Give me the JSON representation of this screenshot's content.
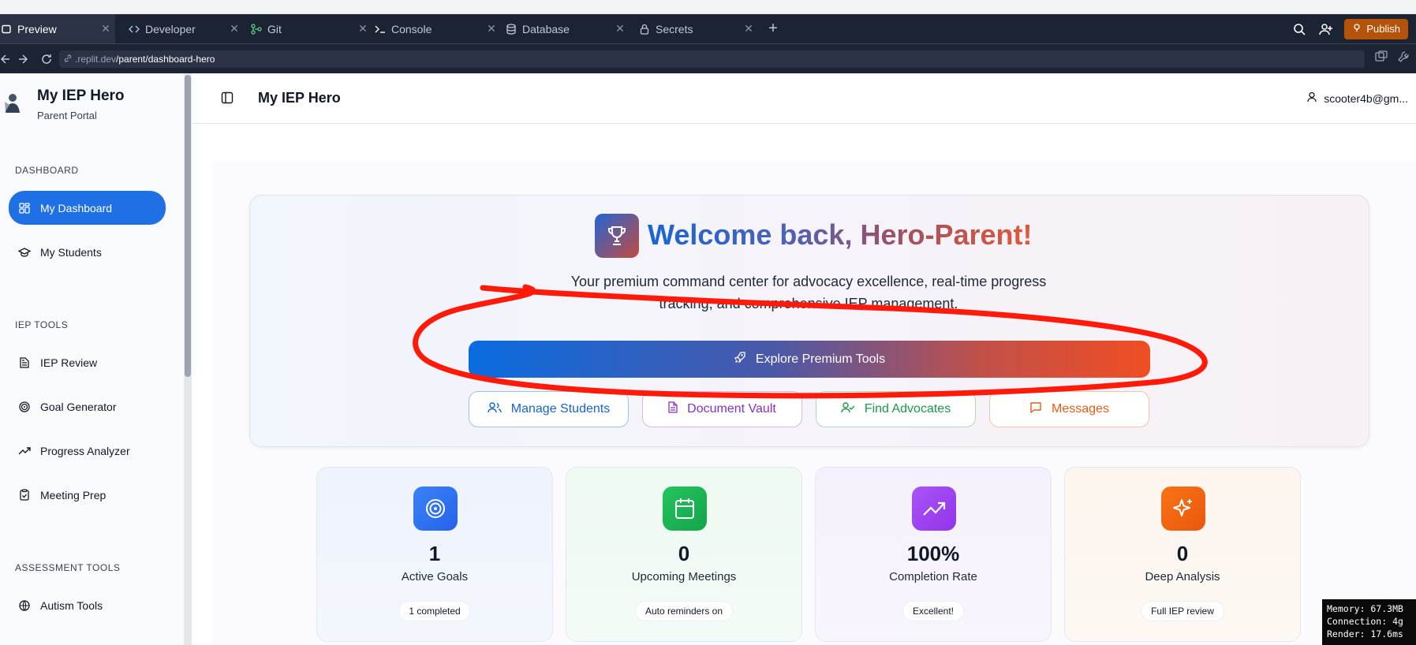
{
  "tabs": [
    {
      "label": "Preview",
      "icon": "preview-icon",
      "active": true
    },
    {
      "label": "Developer",
      "icon": "code-icon"
    },
    {
      "label": "Git",
      "icon": "git-icon"
    },
    {
      "label": "Console",
      "icon": "terminal-icon"
    },
    {
      "label": "Database",
      "icon": "database-icon"
    },
    {
      "label": "Secrets",
      "icon": "lock-icon"
    }
  ],
  "toolbar": {
    "publish_label": "Publish"
  },
  "url": {
    "host": ".replit.dev",
    "path": "/parent/dashboard-hero"
  },
  "sidebar": {
    "brand_title": "My IEP Hero",
    "brand_subtitle": "Parent Portal",
    "sections": [
      {
        "title": "DASHBOARD",
        "items": [
          {
            "label": "My Dashboard",
            "icon": "grid-icon",
            "active": true
          },
          {
            "label": "My Students",
            "icon": "graduation-cap-icon"
          }
        ]
      },
      {
        "title": "IEP TOOLS",
        "items": [
          {
            "label": "IEP Review",
            "icon": "document-icon"
          },
          {
            "label": "Goal Generator",
            "icon": "target-icon"
          },
          {
            "label": "Progress Analyzer",
            "icon": "trending-up-icon"
          },
          {
            "label": "Meeting Prep",
            "icon": "clipboard-check-icon"
          }
        ]
      },
      {
        "title": "ASSESSMENT TOOLS",
        "items": [
          {
            "label": "Autism Tools",
            "icon": "globe-icon"
          }
        ]
      }
    ]
  },
  "header": {
    "title": "My IEP Hero",
    "user": "scooter4b@gm..."
  },
  "hero": {
    "welcome": "Welcome back, Hero-Parent!",
    "subtitle": "Your premium command center for advocacy excellence, real-time progress tracking, and comprehensive IEP management.",
    "cta_label": "Explore Premium Tools",
    "quick_actions": [
      {
        "label": "Manage Students",
        "icon": "users-icon"
      },
      {
        "label": "Document Vault",
        "icon": "file-icon"
      },
      {
        "label": "Find Advocates",
        "icon": "user-check-icon"
      },
      {
        "label": "Messages",
        "icon": "message-icon"
      }
    ]
  },
  "stats": [
    {
      "value": "1",
      "label": "Active Goals",
      "badge": "1 completed",
      "icon": "target-icon"
    },
    {
      "value": "0",
      "label": "Upcoming Meetings",
      "badge": "Auto reminders on",
      "icon": "calendar-icon"
    },
    {
      "value": "100%",
      "label": "Completion Rate",
      "badge": "Excellent!",
      "icon": "trending-up-icon"
    },
    {
      "value": "0",
      "label": "Deep Analysis",
      "badge": "Full IEP review",
      "icon": "sparkles-icon"
    }
  ],
  "debug": {
    "memory": "Memory: 67.3MB",
    "connection": "Connection: 4g",
    "render": "Render: 17.6ms"
  },
  "colors": {
    "accent_blue": "#1f6fe5",
    "annotation_red": "#ff1a0a",
    "publish": "#b45309"
  }
}
